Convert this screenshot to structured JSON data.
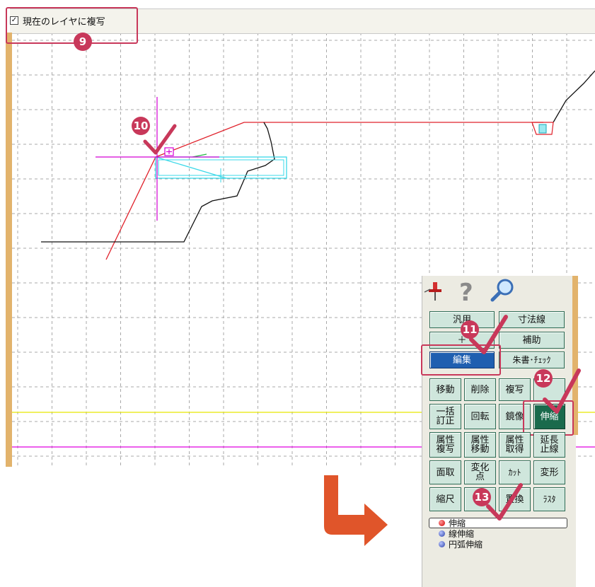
{
  "toolbar": {
    "copy_to_layer_label": "現在のレイヤに複写",
    "copy_to_layer_checked": true
  },
  "steps": {
    "s9": "9",
    "s10": "10",
    "s11": "11",
    "s12": "12",
    "s13": "13"
  },
  "palette": {
    "icons": [
      "pushpin-icon",
      "help-question-icon",
      "zoom-magnifier-icon"
    ],
    "mode_buttons": {
      "generic": "汎用",
      "dimension": "寸法線",
      "plus": "＋",
      "auxiliary": "補助",
      "edit": "編集",
      "redline_check": "朱書･ﾁｪｯｸ"
    },
    "edit_buttons": {
      "move": "移動",
      "delete": "削除",
      "copy": "複写",
      "extra": "",
      "batch_correct": "一括訂正",
      "rotate": "回転",
      "mirror": "鏡像",
      "stretch": "伸縮",
      "attr_copy": "属性複写",
      "attr_move": "属性移動",
      "attr_get": "属性取得",
      "extend_stop": "延長止線",
      "chamfer": "面取",
      "change_point": "変化点",
      "cut": "ｶｯﾄ",
      "deform": "変形",
      "scale": "縮尺",
      "blank": "",
      "replace": "置換",
      "raster": "ﾗｽﾀ"
    },
    "stretch_options": {
      "selected": "伸縮",
      "line": "線伸縮",
      "arc": "円弧伸縮"
    }
  },
  "colors": {
    "highlight": "#c8385a",
    "arrow": "#e0552a",
    "accent_bar": "#e2b36c",
    "active_button": "#1a6a4c",
    "selected_button": "#1f5fb0"
  }
}
